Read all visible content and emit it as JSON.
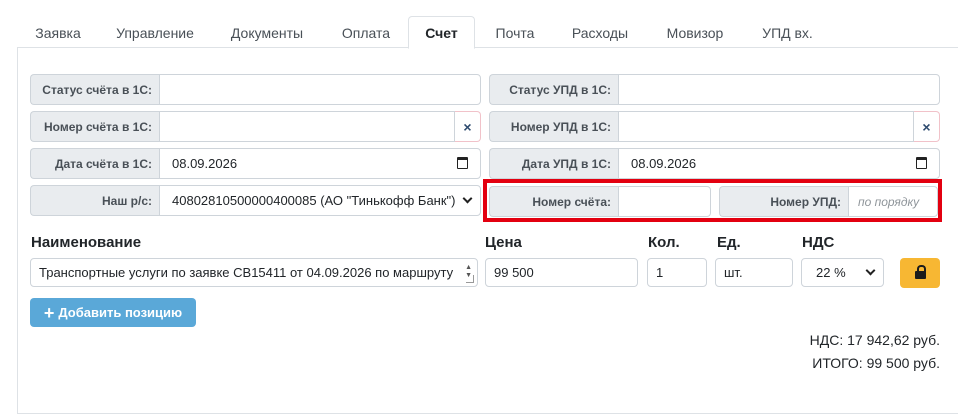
{
  "tabs": [
    "Заявка",
    "Управление",
    "Документы",
    "Оплата",
    "Счет",
    "Почта",
    "Расходы",
    "Мовизор",
    "УПД вх."
  ],
  "active_tab": "Счет",
  "left": {
    "invoice_status_label": "Статус счёта в 1С:",
    "invoice_status_value": "",
    "invoice_number_label": "Номер счёта в 1С:",
    "invoice_number_value": "",
    "invoice_date_label": "Дата счёта в 1С:",
    "invoice_date_value": "08.09.2026",
    "account_label": "Наш р/с:",
    "account_value": "40802810500000400085 (АО \"Тинькофф Банк\")"
  },
  "right": {
    "upd_status_label": "Статус УПД в 1С:",
    "upd_status_value": "",
    "upd_number_label": "Номер УПД в 1С:",
    "upd_number_value": "",
    "upd_date_label": "Дата УПД в 1С:",
    "upd_date_value": "08.09.2026",
    "invoice_no_label": "Номер счёта:",
    "invoice_no_value": "",
    "upd_no_label": "Номер УПД:",
    "upd_no_placeholder": "по порядку"
  },
  "clear_glyph": "×",
  "items": {
    "headers": {
      "name": "Наименование",
      "price": "Цена",
      "qty": "Кол.",
      "unit": "Ед.",
      "vat": "НДС"
    },
    "row": {
      "name": "Транспортные  услуги по заявке СВ15411 от 04.09.2026 по маршруту",
      "price": "99 500",
      "qty": "1",
      "unit": "шт.",
      "vat": "22 %"
    }
  },
  "add_button": "Добавить позицию",
  "totals": {
    "vat": "НДС: 17 942,62 руб.",
    "total": "ИТОГО: 99 500 руб."
  },
  "colors": {
    "highlight": "#e30010",
    "add_button": "#5aa8d8",
    "lock_button": "#f7b733"
  }
}
